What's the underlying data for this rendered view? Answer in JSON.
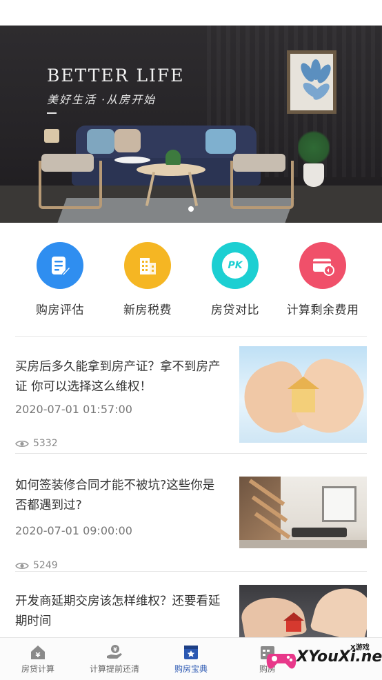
{
  "banner": {
    "title_en": "BETTER LIFE",
    "title_cn": "美好生活 ·从房开始",
    "active_slide": 1,
    "slide_count": 1
  },
  "quick_menu": [
    {
      "label": "购房评估",
      "icon": "document-pen-icon",
      "color": "#2f8ef0"
    },
    {
      "label": "新房税费",
      "icon": "building-icon",
      "color": "#f5b623"
    },
    {
      "label": "房贷对比",
      "icon": "pk-icon",
      "color": "#1ccfd2",
      "icon_text": "PK"
    },
    {
      "label": "计算剩余费用",
      "icon": "card-refund-icon",
      "color": "#f0506a"
    }
  ],
  "articles": [
    {
      "title": "买房后多久能拿到房产证？拿不到房产证 你可以选择这么维权！",
      "date": "2020-07-01 01:57:00",
      "views": "5332",
      "thumb": "heart-hands-house-image"
    },
    {
      "title": "如何签装修合同才能不被坑?这些你是否都遇到过?",
      "date": "2020-07-01 09:00:00",
      "views": "5249",
      "thumb": "interior-living-room-image"
    },
    {
      "title": "开发商延期交房该怎样维权？还要看延期时间",
      "date": "",
      "views": "",
      "thumb": "hands-house-keys-image"
    }
  ],
  "tabbar": {
    "items": [
      {
        "label": "房贷计算",
        "icon": "house-yen-icon"
      },
      {
        "label": "计算提前还清",
        "icon": "hand-coin-icon"
      },
      {
        "label": "购房宝典",
        "icon": "star-book-icon"
      },
      {
        "label": "购房",
        "icon": "calendar-icon"
      }
    ],
    "active": 2,
    "active_color": "#2b58b2"
  },
  "watermark": {
    "text": "XYouXi.net",
    "small": "X游戏"
  }
}
